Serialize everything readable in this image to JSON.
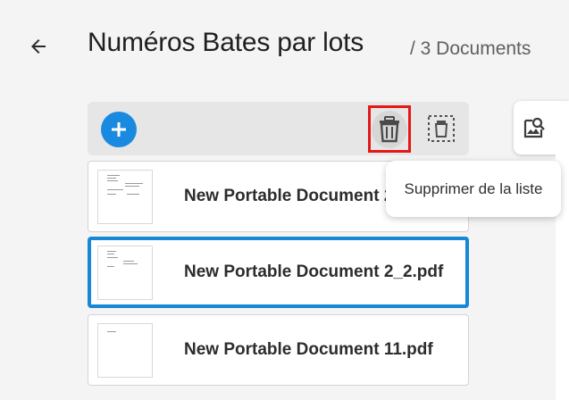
{
  "header": {
    "back_icon": "arrow-left-icon",
    "title": "Numéros Bates par lots",
    "count": "/ 3 Documents"
  },
  "toolbar": {
    "add_icon": "plus-icon",
    "delete_icon": "trash-icon",
    "select_icon": "select-all-icon",
    "accent_color": "#1a8ae0",
    "highlight_color": "#e41818"
  },
  "side_panel": {
    "icon": "image-search-icon"
  },
  "tooltip": {
    "text": "Supprimer de la liste"
  },
  "documents": [
    {
      "name": "New Portable Document 2.pdf",
      "selected": false
    },
    {
      "name": "New Portable Document 2_2.pdf",
      "selected": true
    },
    {
      "name": "New Portable Document 11.pdf",
      "selected": false
    }
  ]
}
